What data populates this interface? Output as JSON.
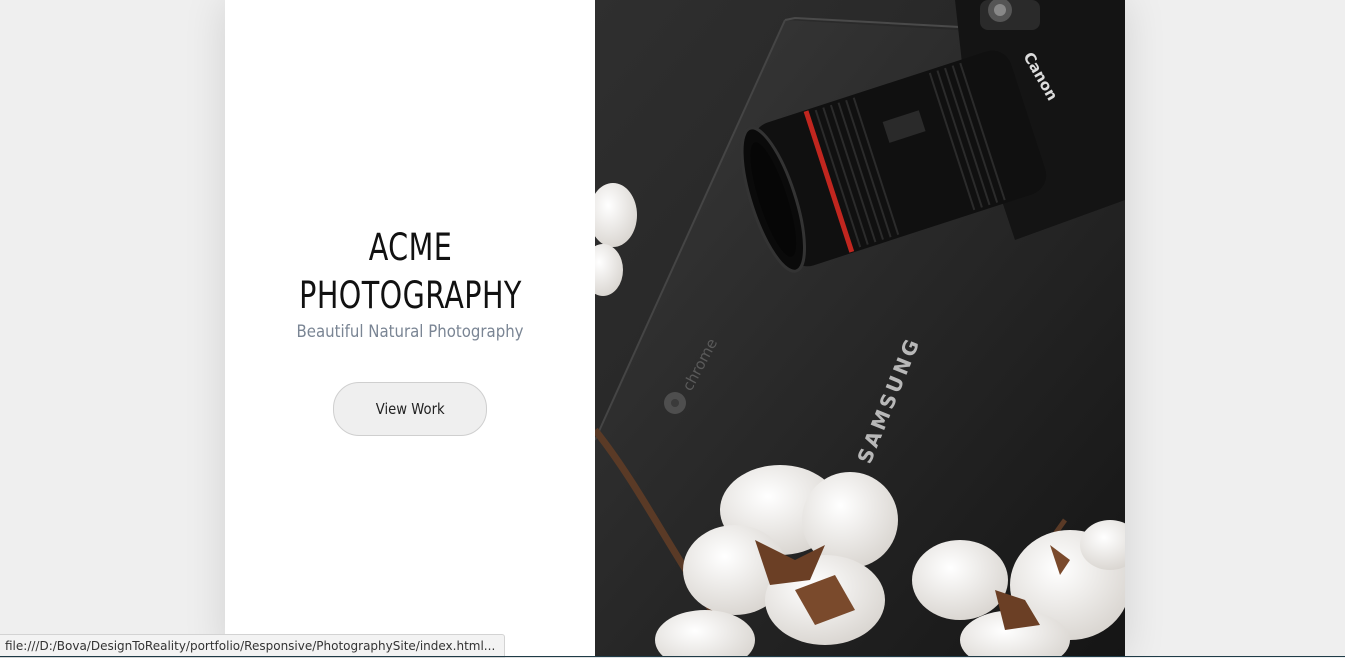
{
  "hero": {
    "title_line1": "ACME",
    "title_line2": "PHOTOGRAPHY",
    "tagline": "Beautiful Natural Photography",
    "cta_label": "View Work"
  },
  "photo": {
    "description_icon": "camera-on-laptop-photo",
    "camera_brand_text": "Canon",
    "laptop_brand_text": "SAMSUNG",
    "laptop_os_text": "chrome"
  },
  "status_bar": {
    "url": "file:///D:/Bova/DesignToReality/portfolio/Responsive/PhotographySite/index.html..."
  },
  "colors": {
    "page_bg": "#efefef",
    "panel_bg": "#ffffff",
    "tagline": "#7a8594",
    "button_bg": "#efefef"
  }
}
